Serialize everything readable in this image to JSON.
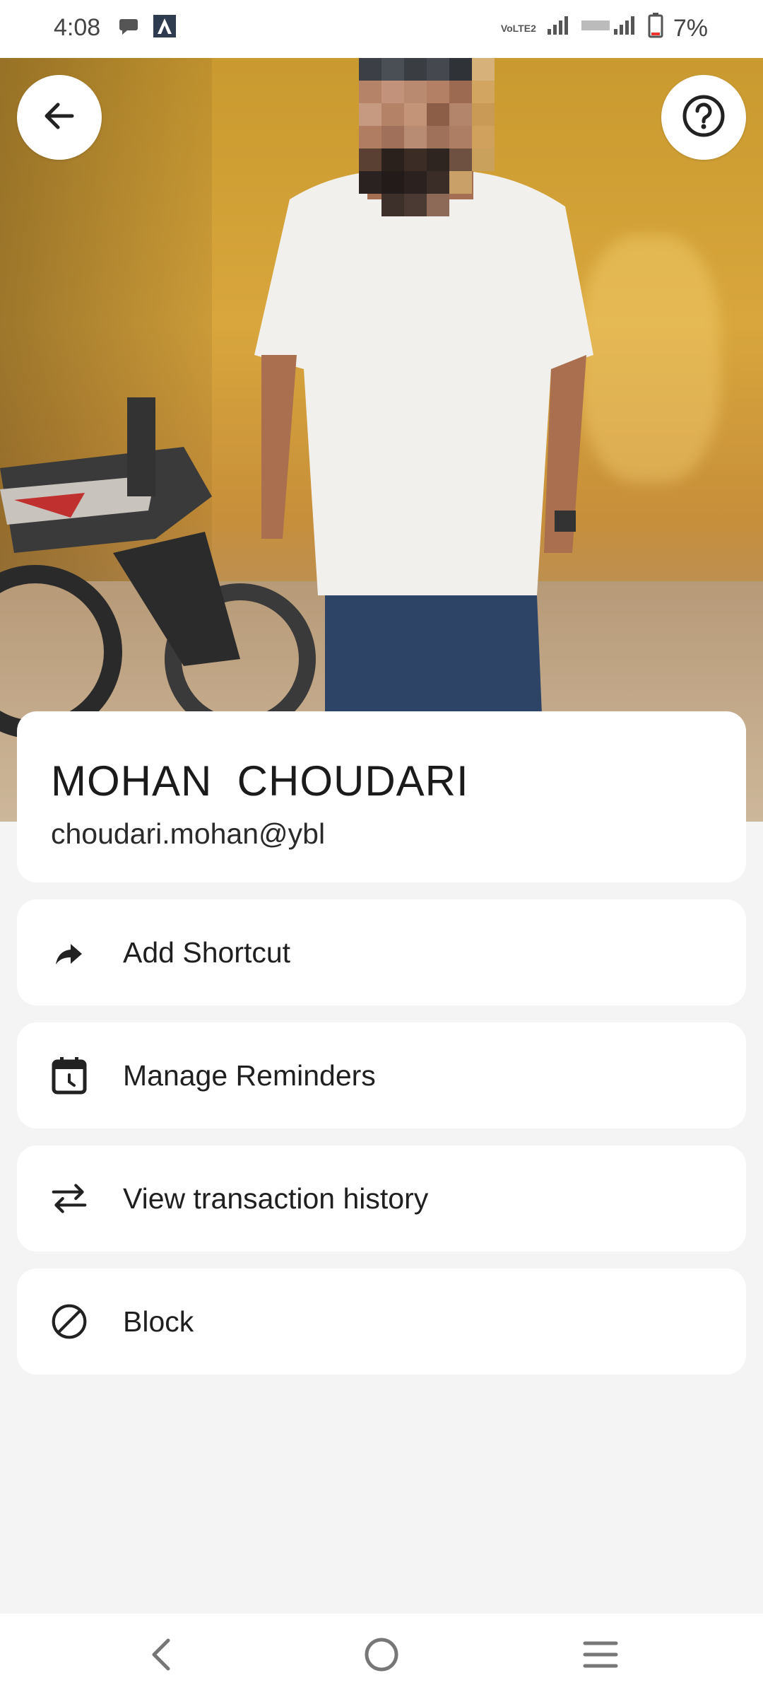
{
  "status_bar": {
    "time": "4:08",
    "battery": "7%",
    "network_label": "VoLTE2",
    "icons": [
      "chat-icon",
      "app-a-icon",
      "volte-icon",
      "signal-icon",
      "signal-icon-2",
      "battery-icon"
    ]
  },
  "header": {
    "back_icon": "arrow-left-icon",
    "help_icon": "help-circle-icon"
  },
  "profile": {
    "name": "MOHAN  CHOUDARI",
    "upi_id": "choudari.mohan@ybl"
  },
  "actions": [
    {
      "label": "Add Shortcut",
      "icon": "share-arrow-icon"
    },
    {
      "label": "Manage Reminders",
      "icon": "calendar-clock-icon"
    },
    {
      "label": "View transaction history",
      "icon": "swap-arrows-icon"
    },
    {
      "label": "Block",
      "icon": "block-icon"
    }
  ],
  "nav": {
    "icons": [
      "nav-back-icon",
      "nav-home-icon",
      "nav-menu-icon"
    ]
  },
  "colors": {
    "background": "#f4f4f5",
    "card": "#ffffff",
    "text": "#1f1f1f"
  }
}
